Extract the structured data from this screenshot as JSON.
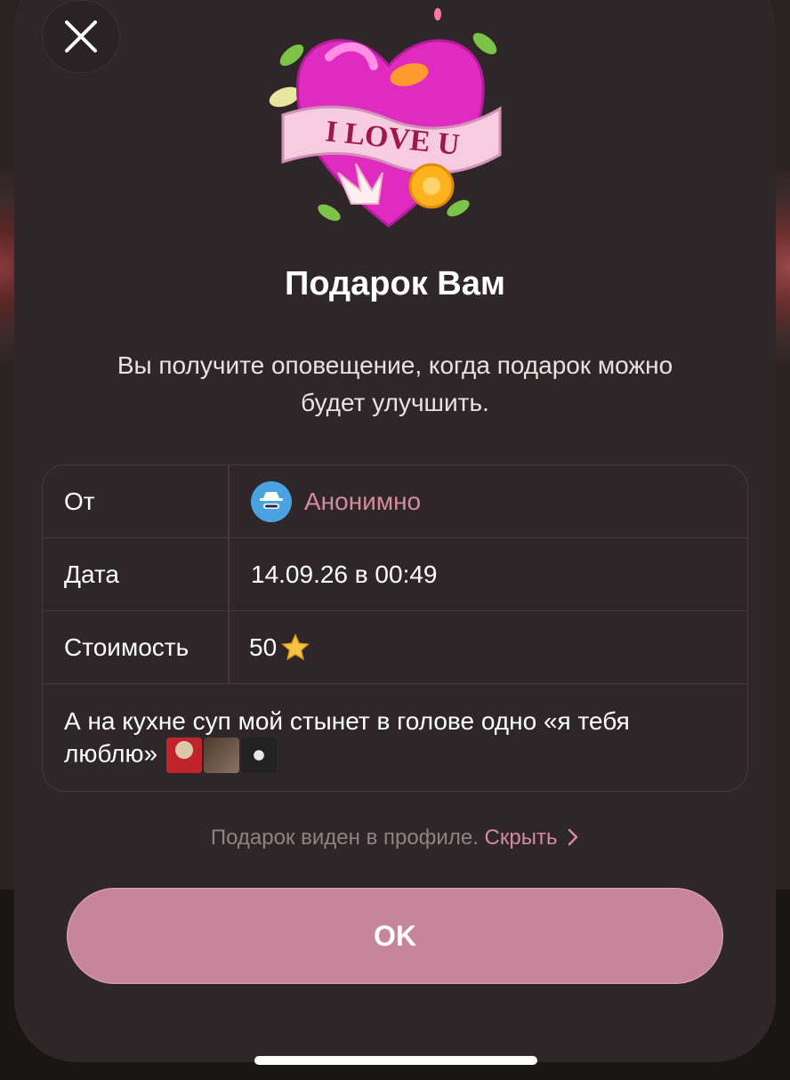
{
  "gift": {
    "banner_text": "I LOVE U",
    "title": "Подарок Вам",
    "subtitle": "Вы получите оповещение, когда подарок можно будет улучшить."
  },
  "info": {
    "from_label": "От",
    "from_value": "Анонимно",
    "date_label": "Дата",
    "date_value": "14.09.26 в 00:49",
    "price_label": "Стоимость",
    "price_value": "50",
    "price_icon": "star-icon",
    "message_text": "А на кухне суп мой стынет в голове одно «я тебя люблю»"
  },
  "footer": {
    "visibility_note": "Подарок виден в профиле.",
    "hide_link": "Скрыть"
  },
  "actions": {
    "ok_label": "OK",
    "close_icon": "close-icon"
  },
  "colors": {
    "sheet_bg": "#2e2628",
    "accent": "#d48ba2",
    "button_bg": "#c6859b",
    "anon_avatar": "#4aa3e0"
  }
}
